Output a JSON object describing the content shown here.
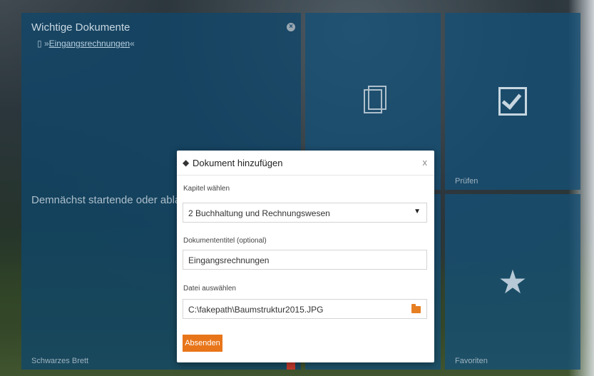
{
  "tiles": {
    "important_docs": {
      "title": "Wichtige Dokumente",
      "close_symbol": "×",
      "link_prefix": "»",
      "link_text": "Eingangsrechnungen",
      "link_suffix": "«",
      "upcoming_text": "Demnächst startende oder ablaufende",
      "footer": "Schwarzes Brett"
    },
    "check": {
      "footer": "Prüfen"
    },
    "favorites": {
      "footer": "Favoriten"
    }
  },
  "modal": {
    "title": "Dokument hinzufügen",
    "close_symbol": "x",
    "chapter_label": "Kapitel wählen",
    "chapter_value": "2 Buchhaltung und Rechnungswesen",
    "doc_title_label": "Dokumententitel (optional)",
    "doc_title_value": "Eingangsrechnungen",
    "file_label": "Datei auswählen",
    "file_value": "C:\\fakepath\\Baumstruktur2015.JPG",
    "submit_label": "Absenden"
  },
  "icons": [
    "documents-icon",
    "checkbox-icon",
    "star-icon",
    "folder-icon",
    "add-document-icon",
    "close-icon"
  ],
  "colors": {
    "tile": "#145076",
    "accent": "#e8751a"
  }
}
